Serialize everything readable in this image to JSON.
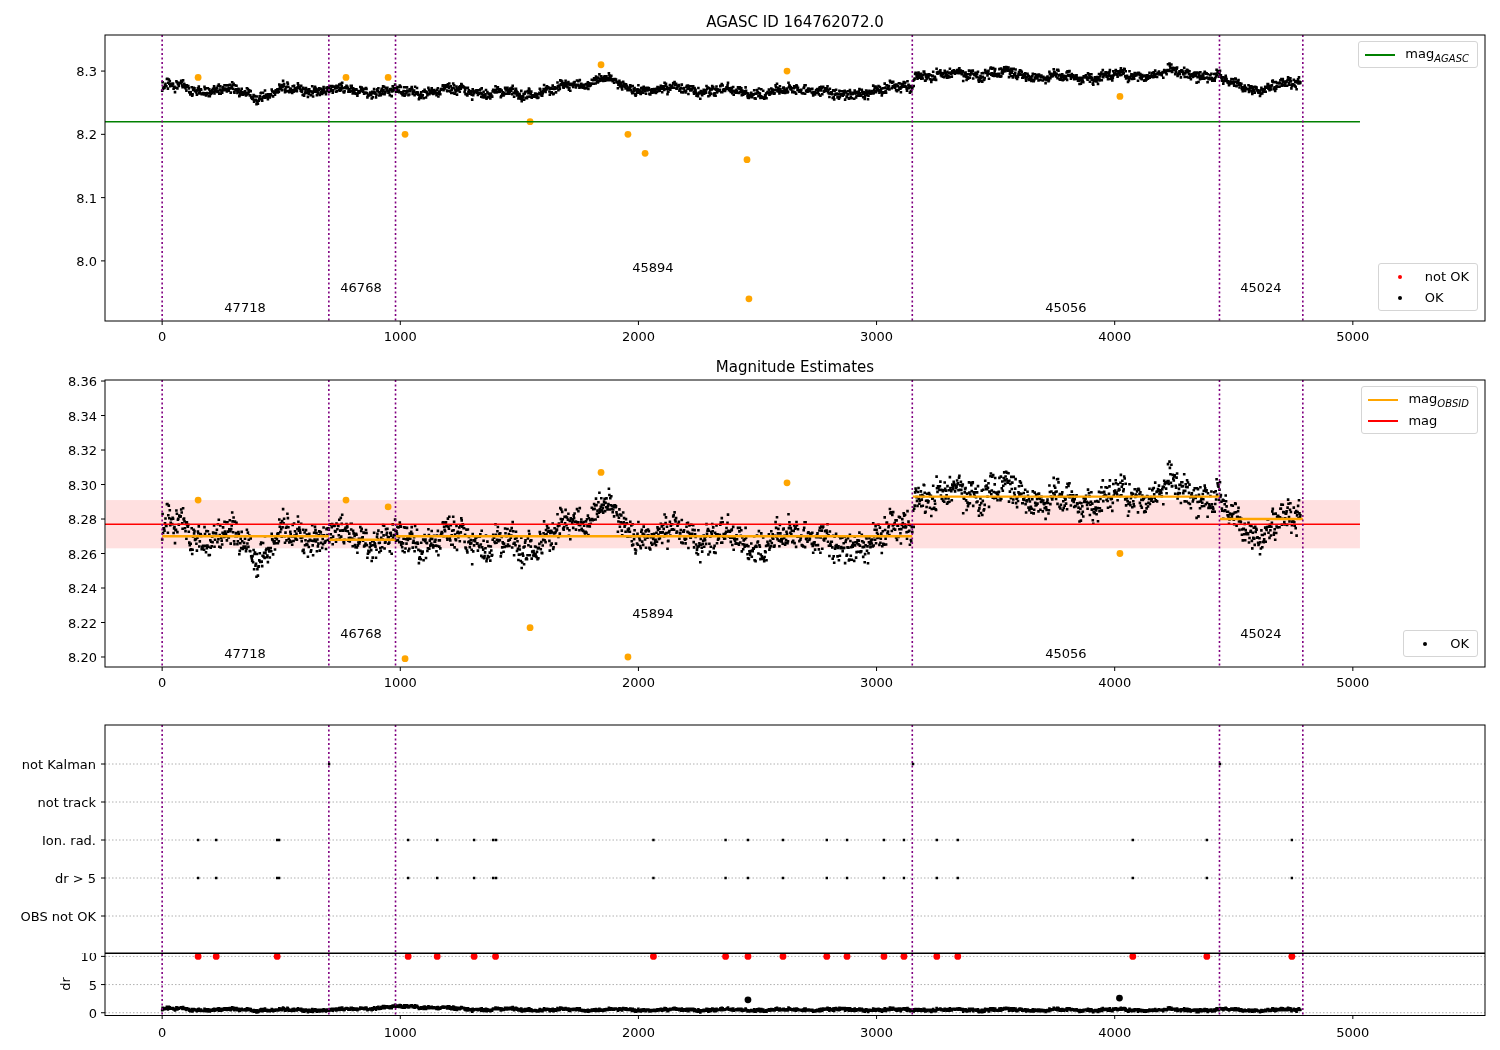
{
  "figure": {
    "panels": [
      {
        "chart_data": {
          "type": "scatter",
          "title": "AGASC ID 164762072.0",
          "legend": true,
          "xlim": [
            -240,
            5555
          ],
          "ylim": [
            7.905,
            8.357
          ],
          "xticks": [
            0,
            1000,
            2000,
            3000,
            4000,
            5000
          ],
          "yticks": [
            {
              "value": 8.0,
              "label": "8.0"
            },
            {
              "value": 8.1,
              "label": "8.1"
            },
            {
              "value": 8.2,
              "label": "8.2"
            },
            {
              "value": 8.3,
              "label": "8.3"
            }
          ],
          "series": [
            {
              "color": "#ffa500",
              "x": [
                151,
                772,
                949,
                1020,
                1545,
                1843,
                1956,
                2028,
                2456,
                2464,
                2624,
                4022
              ],
              "values": [
                8.29,
                8.29,
                8.29,
                8.2,
                8.22,
                8.31,
                8.2,
                8.17,
                8.16,
                7.94,
                8.3,
                8.26
              ]
            },
            {
              "type": "line",
              "name": "mag$_{AGASC}$",
              "color": "#008000",
              "x": [
                -240,
                5030
              ],
              "values": [
                8.22,
                8.22
              ]
            }
          ],
          "ref_lines": [
            {
              "axis": "x",
              "value": 0,
              "color": "#800080"
            },
            {
              "axis": "x",
              "value": 700,
              "color": "#800080"
            },
            {
              "axis": "x",
              "value": 980,
              "color": "#800080"
            },
            {
              "axis": "x",
              "value": 3150,
              "color": "#800080"
            },
            {
              "axis": "x",
              "value": 4440,
              "color": "#800080"
            },
            {
              "axis": "x",
              "value": 4790,
              "color": "#800080"
            }
          ],
          "annotations": [
            "47718",
            "46768",
            "45894",
            "45056",
            "45024"
          ]
        },
        "legend": [
          {
            "label": "not OK",
            "color": "#ff0000"
          },
          {
            "label": "OK",
            "color": "#000000"
          }
        ]
      },
      {
        "chart_data": {
          "type": "line",
          "title": "Magnitude Estimates",
          "legend": true,
          "xlim": [
            -240,
            5555
          ],
          "ylim": [
            8.1942,
            8.3606
          ],
          "xticks": [
            0,
            1000,
            2000,
            3000,
            4000,
            5000
          ],
          "yticks": [
            {
              "value": 8.2,
              "label": "8.20"
            },
            {
              "value": 8.22,
              "label": "8.22"
            },
            {
              "value": 8.24,
              "label": "8.24"
            },
            {
              "value": 8.26,
              "label": "8.26"
            },
            {
              "value": 8.28,
              "label": "8.28"
            },
            {
              "value": 8.3,
              "label": "8.30"
            },
            {
              "value": 8.32,
              "label": "8.32"
            },
            {
              "value": 8.34,
              "label": "8.34"
            },
            {
              "value": 8.36,
              "label": "8.36"
            }
          ],
          "series": [
            {
              "name": "mag$_{OBSID}$",
              "color": "#ffa500",
              "x": [
                0,
                700,
                701,
                702,
                980,
                981,
                982,
                3150,
                3151,
                3152,
                4440,
                4441,
                4442,
                4790
              ],
              "values": [
                8.27,
                8.27,
                null,
                8.268,
                8.268,
                null,
                8.27,
                8.27,
                null,
                8.293,
                8.293,
                null,
                8.28,
                8.28
              ]
            },
            {
              "name": "mag",
              "color": "#ff0000",
              "x": [
                -240,
                5030
              ],
              "values": [
                8.277,
                8.277
              ]
            },
            {
              "type": "scatter",
              "color": "#ffa500",
              "x": [
                151,
                772,
                949,
                1020,
                1545,
                1843,
                1956,
                2624,
                4022
              ],
              "values": [
                8.291,
                8.291,
                8.287,
                8.199,
                8.217,
                8.307,
                8.2,
                8.301,
                8.26
              ]
            }
          ],
          "bands": [
            {
              "axis": "y",
              "from": 8.263,
              "to": 8.291,
              "color": "#ff0000"
            }
          ],
          "ref_lines": [
            {
              "axis": "x",
              "value": 0,
              "color": "#800080"
            },
            {
              "axis": "x",
              "value": 700,
              "color": "#800080"
            },
            {
              "axis": "x",
              "value": 980,
              "color": "#800080"
            },
            {
              "axis": "x",
              "value": 3150,
              "color": "#800080"
            },
            {
              "axis": "x",
              "value": 4440,
              "color": "#800080"
            },
            {
              "axis": "x",
              "value": 4790,
              "color": "#800080"
            }
          ],
          "annotations": [
            "47718",
            "46768",
            "45894",
            "45056",
            "45024"
          ]
        },
        "legend": [
          {
            "label": "OK",
            "color": "#000000"
          }
        ]
      },
      {
        "flag_rows": [
          {
            "label": "not Kalman"
          },
          {
            "label": "not track"
          },
          {
            "label": "Ion. rad."
          },
          {
            "label": "dr > 5"
          },
          {
            "label": "OBS not OK"
          }
        ]
      },
      {
        "chart_data": {
          "type": "scatter",
          "ylabel": "dr",
          "grid": true,
          "xlim": [
            -240,
            5555
          ],
          "ylim": [
            -0.4,
            10.6
          ],
          "xticks": [
            0,
            1000,
            2000,
            3000,
            4000,
            5000
          ],
          "yticks": [
            0,
            5,
            10
          ],
          "series": [
            {
              "color": "#000000",
              "x": [
                2460,
                4020
              ],
              "values": [
                2.3,
                2.6
              ]
            },
            {
              "color": "#ff0000",
              "x": [
                151,
                227,
                483,
                1033,
                1155,
                1310,
                1400,
                2063,
                2366,
                2460,
                2607,
                2791,
                2876,
                3031,
                3115,
                3253,
                3341,
                4076,
                4387,
                4744
              ],
              "values": [
                10,
                10,
                10,
                10,
                10,
                10,
                10,
                10,
                10,
                10,
                10,
                10,
                10,
                10,
                10,
                10,
                10,
                10,
                10,
                10
              ]
            }
          ],
          "ref_lines": [
            {
              "axis": "x",
              "value": 0,
              "color": "#800080"
            },
            {
              "axis": "x",
              "value": 700,
              "color": "#800080"
            },
            {
              "axis": "x",
              "value": 980,
              "color": "#800080"
            },
            {
              "axis": "x",
              "value": 3150,
              "color": "#800080"
            },
            {
              "axis": "x",
              "value": 4440,
              "color": "#800080"
            },
            {
              "axis": "x",
              "value": 4790,
              "color": "#800080"
            }
          ]
        }
      }
    ]
  }
}
